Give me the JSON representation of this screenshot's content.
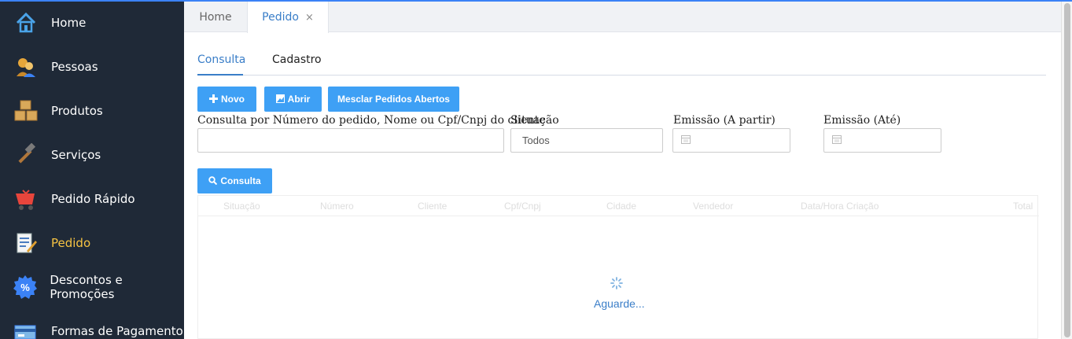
{
  "sidebar": {
    "items": [
      {
        "label": "Home",
        "icon": "home-icon"
      },
      {
        "label": "Pessoas",
        "icon": "people-icon"
      },
      {
        "label": "Produtos",
        "icon": "boxes-icon"
      },
      {
        "label": "Serviços",
        "icon": "hammer-icon"
      },
      {
        "label": "Pedido Rápido",
        "icon": "cart-icon"
      },
      {
        "label": "Pedido",
        "icon": "document-edit-icon"
      },
      {
        "label": "Descontos e Promoções",
        "icon": "discount-icon"
      },
      {
        "label": "Formas de Pagamento",
        "icon": "payment-card-icon"
      }
    ],
    "active": "Pedido"
  },
  "tabs": {
    "home": "Home",
    "pedido": "Pedido",
    "close": "×"
  },
  "subtabs": {
    "consulta": "Consulta",
    "cadastro": "Cadastro"
  },
  "buttons": {
    "novo": "Novo",
    "abrir": "Abrir",
    "mesclar": "Mesclar Pedidos Abertos",
    "consulta": "Consulta"
  },
  "form": {
    "search_label": "Consulta por Número do pedido, Nome ou Cpf/Cnpj do cliente",
    "search_value": "",
    "situacao_label": "Situação",
    "situacao_value": "Todos",
    "emissao_from_label": "Emissão (A partir)",
    "emissao_to_label": "Emissão (Até)"
  },
  "grid": {
    "columns": [
      "Situação",
      "Número",
      "Cliente",
      "Cpf/Cnpj",
      "Cidade",
      "Vendedor",
      "Data/Hora Criação",
      "Total"
    ]
  },
  "loading": {
    "text": "Aguarde..."
  },
  "colors": {
    "accent": "#3ea0f5",
    "sidebar_bg": "#1f2937",
    "active_item": "#f6c343",
    "link_blue": "#3a7ec8"
  }
}
